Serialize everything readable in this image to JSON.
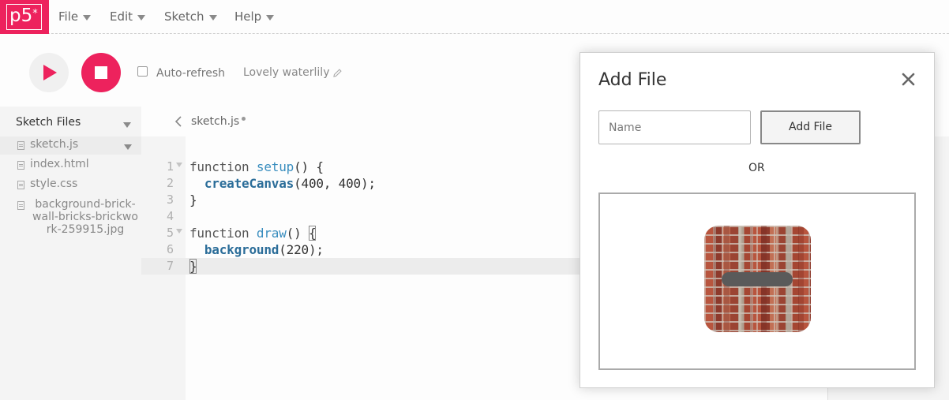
{
  "nav": {
    "logo": "p5",
    "logo_sup": "*",
    "menus": [
      {
        "label": "File"
      },
      {
        "label": "Edit"
      },
      {
        "label": "Sketch"
      },
      {
        "label": "Help"
      }
    ]
  },
  "toolbar": {
    "auto_refresh_label": "Auto-refresh",
    "auto_refresh_checked": false,
    "project_name": "Lovely waterlily"
  },
  "sidebar": {
    "title": "Sketch Files",
    "files": [
      {
        "name": "sketch.js",
        "active": true
      },
      {
        "name": "index.html"
      },
      {
        "name": "style.css"
      },
      {
        "name": "background-brick-wall-bricks-brickwork-259915.jpg"
      }
    ]
  },
  "editor": {
    "tab": "sketch.js",
    "lines": [
      {
        "n": "1"
      },
      {
        "n": "2"
      },
      {
        "n": "3"
      },
      {
        "n": "4"
      },
      {
        "n": "5"
      },
      {
        "n": "6"
      },
      {
        "n": "7"
      }
    ],
    "code": {
      "l1_kw": "function ",
      "l1_fn": "setup",
      "l1_rest": "() {",
      "l2_fn": "createCanvas",
      "l2_rest": "(400, 400);",
      "l3": "}",
      "l5_kw": "function ",
      "l5_fn": "draw",
      "l5_rest": "() ",
      "l5_brace": "{",
      "l6_fn": "background",
      "l6_rest": "(220);",
      "l7": "}"
    }
  },
  "modal": {
    "title": "Add File",
    "name_placeholder": "Name",
    "add_button": "Add File",
    "or": "OR"
  },
  "colors": {
    "brand": "#ed225d"
  }
}
